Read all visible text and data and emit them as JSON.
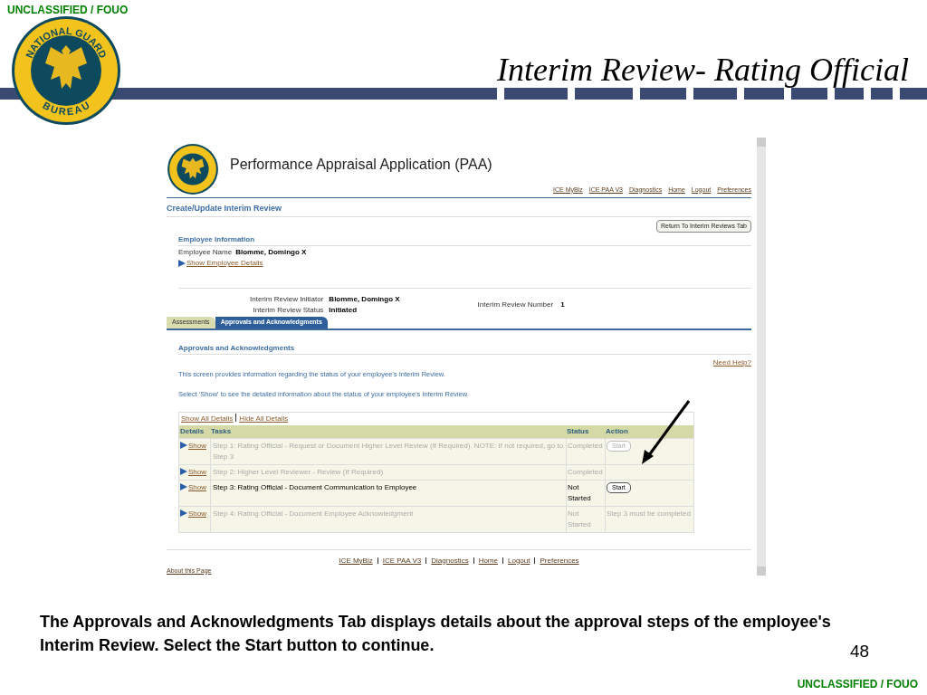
{
  "classification_top": "UNCLASSIFIED / FOUO",
  "logo": {
    "top_text": "NATIONAL GUARD",
    "bottom_text": "BUREAU"
  },
  "title": "Interim Review- Rating Official",
  "app": {
    "title": "Performance Appraisal Application (PAA)",
    "header_links": [
      "ICE MyBiz",
      "ICE PAA V3",
      "Diagnostics",
      "Home",
      "Logout",
      "Preferences"
    ],
    "page_title": "Create/Update Interim Review",
    "return_button": "Return To Interim Reviews Tab",
    "employee": {
      "heading": "Employee Information",
      "name_label": "Employee Name",
      "name_value": "Blomme, Domingo X",
      "details_link": "Show Employee Details"
    },
    "review_info": [
      {
        "label": "Interim Review Initiator",
        "value": "Blomme, Domingo X"
      },
      {
        "label": "Interim Review Status",
        "value": "Initiated"
      }
    ],
    "number": {
      "label": "Interim Review Number",
      "value": "1"
    },
    "tabs": [
      {
        "label": "Assessments",
        "selected": false
      },
      {
        "label": "Approvals and Acknowledgments",
        "selected": true
      }
    ],
    "section_heading": "Approvals and Acknowledgments",
    "help_link": "Need Help?",
    "paragraphs": [
      "This screen provides information regarding the status of your employee's Interim Review.",
      "Select 'Show' to see the detailed information about the status of your employee's Interim Review."
    ],
    "detail_links": [
      "Show All Details",
      "Hide All Details"
    ],
    "table": {
      "columns": [
        "Details",
        "Tasks",
        "Status",
        "Action"
      ],
      "rows": [
        {
          "show": "Show",
          "task": "Step 1: Rating Official - Request or Document Higher Level Review (If Required). NOTE: If not required, go to Step 3",
          "status": "Completed",
          "disabled": true,
          "action": {
            "kind": "button",
            "label": "Start",
            "disabled": true
          }
        },
        {
          "show": "Show",
          "task": "Step 2: Higher Level Reviewer - Review (If Required)",
          "status": "Completed",
          "disabled": true
        },
        {
          "show": "Show",
          "task": "Step 3: Rating Official - Document Communication to Employee",
          "status": "Not Started",
          "disabled": false,
          "action": {
            "kind": "button",
            "label": "Start",
            "disabled": false
          }
        },
        {
          "show": "Show",
          "task": "Step 4: Rating Official - Document Employee Acknowledgment",
          "status": "Not Started",
          "disabled": true,
          "action": {
            "kind": "text",
            "label": "Step 3 must be completed"
          }
        }
      ]
    },
    "footer_links": [
      "ICE MyBiz",
      "ICE PAA V3",
      "Diagnostics",
      "Home",
      "Logout",
      "Preferences"
    ],
    "about_link": "About this Page"
  },
  "caption": "The Approvals and Acknowledgments Tab displays details about the approval steps of the employee's Interim Review. Select the Start button to continue.",
  "page_number": "48",
  "classification_bottom": "UNCLASSIFIED / FOUO"
}
